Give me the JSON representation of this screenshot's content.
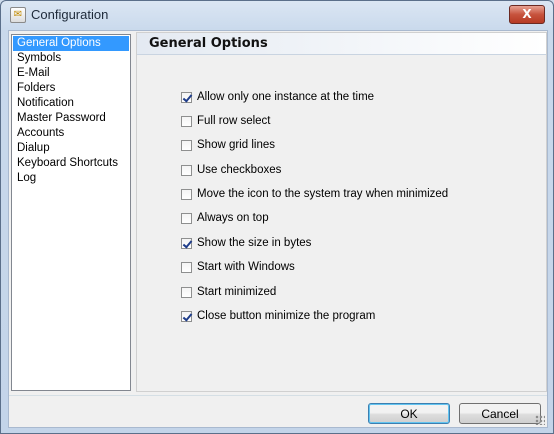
{
  "window": {
    "title": "Configuration",
    "close_label": "X"
  },
  "sidebar": {
    "items": [
      {
        "label": "General Options",
        "selected": true
      },
      {
        "label": "Symbols"
      },
      {
        "label": "E-Mail"
      },
      {
        "label": "Folders"
      },
      {
        "label": "Notification"
      },
      {
        "label": "Master Password"
      },
      {
        "label": "Accounts"
      },
      {
        "label": "Dialup"
      },
      {
        "label": "Keyboard Shortcuts"
      },
      {
        "label": "Log"
      }
    ]
  },
  "panel": {
    "title": "General Options",
    "options": [
      {
        "label": "Allow only one instance at the time",
        "checked": true
      },
      {
        "label": "Full row select",
        "checked": false
      },
      {
        "label": "Show grid lines",
        "checked": false
      },
      {
        "label": "Use checkboxes",
        "checked": false
      },
      {
        "label": "Move the icon to the system tray when minimized",
        "checked": false
      },
      {
        "label": "Always on top",
        "checked": false
      },
      {
        "label": "Show the size in bytes",
        "checked": true
      },
      {
        "label": "Start with Windows",
        "checked": false
      },
      {
        "label": "Start minimized",
        "checked": false
      },
      {
        "label": "Close button minimize the program",
        "checked": true
      }
    ]
  },
  "footer": {
    "ok_label": "OK",
    "cancel_label": "Cancel"
  }
}
